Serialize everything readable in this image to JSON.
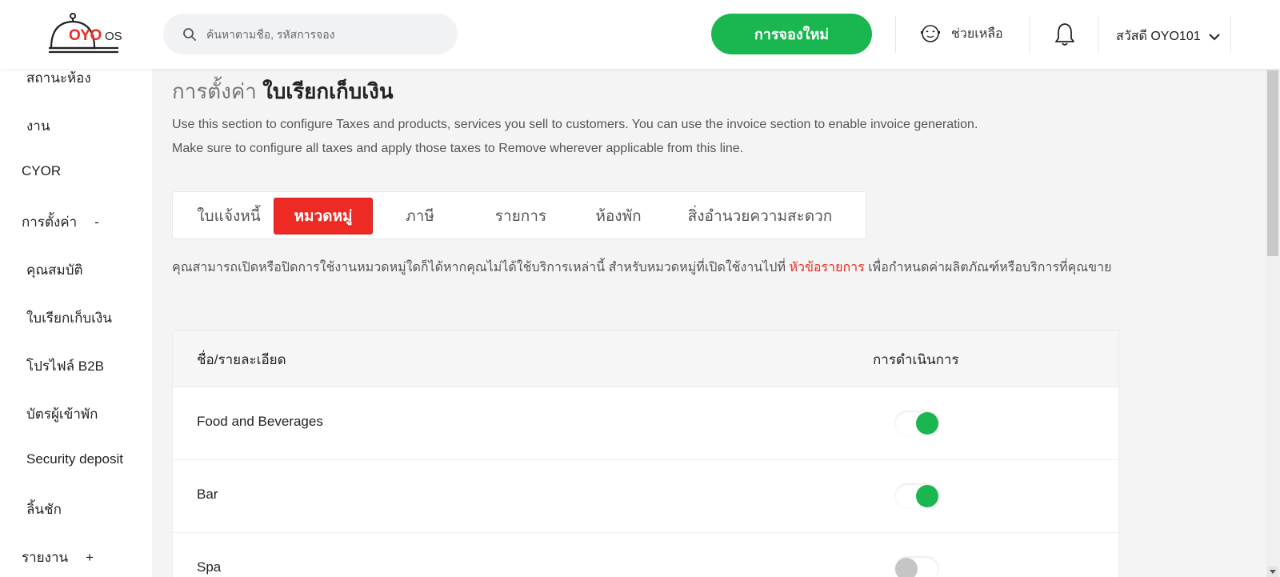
{
  "header": {
    "logo_text": "OYO",
    "logo_os": "OS",
    "search_placeholder": "ค้นหาตามชื่อ, รหัสการจอง",
    "new_booking_label": "การจองใหม่",
    "help_label": "ช่วยเหลือ",
    "user_greeting": "สวัสดี OYO101",
    "brand_color": "#ee2a24",
    "accent_color": "#1ab64f",
    "icons": {
      "search": "search-icon",
      "help": "support-agent-icon",
      "bell": "bell-icon",
      "chevron": "chevron-down-icon"
    }
  },
  "sidebar": {
    "items": [
      {
        "label": "สถานะห้อง",
        "level": "sub"
      },
      {
        "label": "งาน",
        "level": "sub"
      },
      {
        "label": "CYOR",
        "level": "top"
      },
      {
        "label": "การตั้งค่า",
        "level": "top",
        "toggle": "-"
      },
      {
        "label": "คุณสมบัติ",
        "level": "sub"
      },
      {
        "label": "ใบเรียกเก็บเงิน",
        "level": "sub"
      },
      {
        "label": "โปรไฟล์ B2B",
        "level": "sub"
      },
      {
        "label": "บัตรผู้เข้าพัก",
        "level": "sub"
      },
      {
        "label": "Security deposit",
        "level": "sub"
      },
      {
        "label": "ลิ้นชัก",
        "level": "sub"
      },
      {
        "label": "รายงาน",
        "level": "top",
        "toggle": "+"
      }
    ]
  },
  "main": {
    "title_crumb": "การตั้งค่า",
    "title_current": "ใบเรียกเก็บเงิน",
    "description_line1": "Use this section to configure Taxes and products, services you sell to customers. You can use the invoice section to enable invoice generation.",
    "description_line2": "Make sure to configure all taxes and apply those taxes to Remove wherever applicable from this line.",
    "tabs": [
      {
        "label": "ใบแจ้งหนี้",
        "active": false
      },
      {
        "label": "หมวดหมู่",
        "active": true
      },
      {
        "label": "ภาษี",
        "active": false
      },
      {
        "label": "รายการ",
        "active": false
      },
      {
        "label": "ห้องพัก",
        "active": false
      },
      {
        "label": "สิ่งอำนวยความสะดวก",
        "active": false
      }
    ],
    "info_text_before": "คุณสามารถเปิดหรือปิดการใช้งานหมวดหมู่ใดก็ได้หากคุณไม่ได้ใช้บริการเหล่านี้ สำหรับหมวดหมู่ที่เปิดใช้งานไปที่",
    "info_link": "หัวข้อรายการ",
    "info_text_after": "เพื่อกำหนดค่าผลิตภัณฑ์หรือบริการที่คุณขาย",
    "table": {
      "col_name": "ชื่อ/รายละเอียด",
      "col_action": "การดำเนินการ",
      "rows": [
        {
          "name": "Food and Beverages",
          "enabled": true
        },
        {
          "name": "Bar",
          "enabled": true
        },
        {
          "name": "Spa",
          "enabled": false
        }
      ]
    }
  }
}
